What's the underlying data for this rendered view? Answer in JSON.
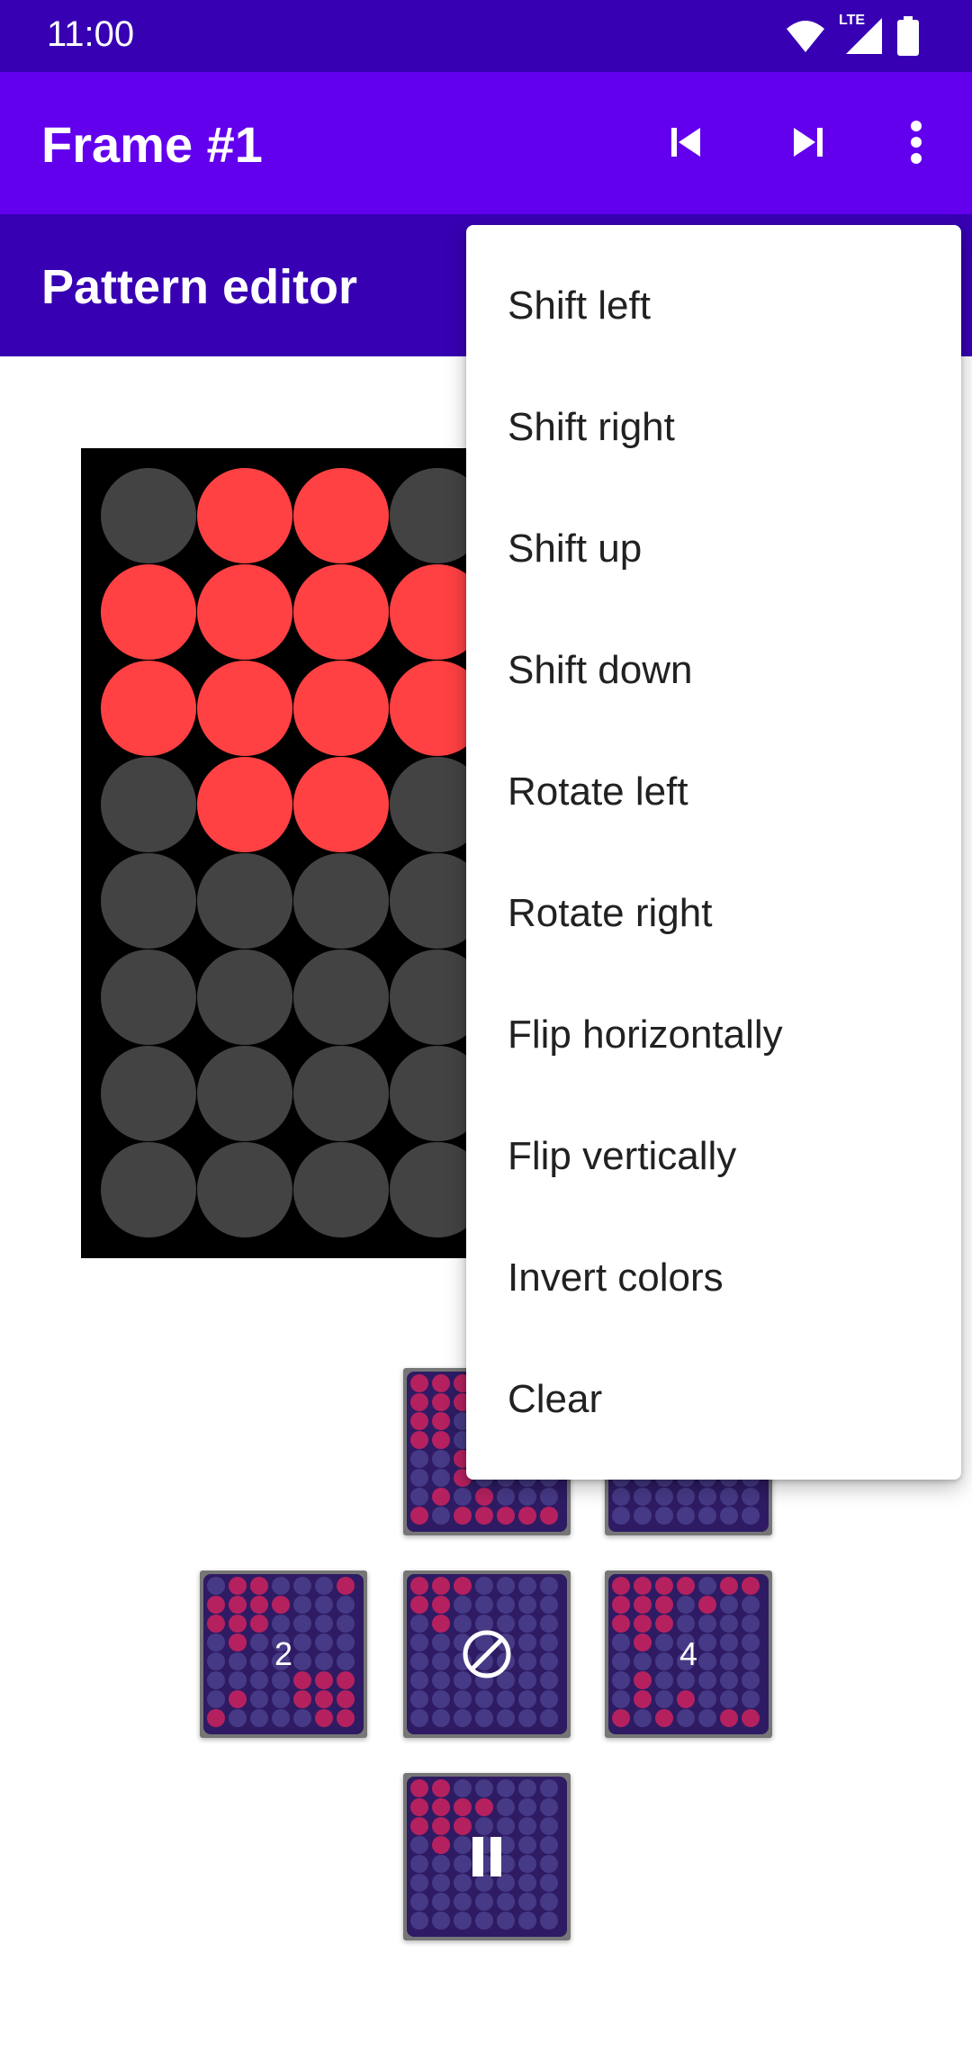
{
  "status": {
    "time": "11:00",
    "network": "LTE"
  },
  "toolbar": {
    "title": "Frame #1"
  },
  "header": {
    "title": "Pattern editor"
  },
  "colors": {
    "primary": "#6200ee",
    "primary_dark": "#3700b3",
    "led_on": "#ff4143",
    "led_off": "#434343",
    "thumb_on": "#b5215f",
    "thumb_off": "#463a86"
  },
  "pattern": {
    "grid": [
      [
        0,
        1,
        1,
        0
      ],
      [
        1,
        1,
        1,
        1
      ],
      [
        1,
        1,
        1,
        1
      ],
      [
        0,
        1,
        1,
        0
      ],
      [
        0,
        0,
        0,
        0
      ],
      [
        0,
        0,
        0,
        0
      ],
      [
        0,
        0,
        0,
        0
      ],
      [
        0,
        0,
        0,
        0
      ]
    ]
  },
  "thumbnails": [
    {
      "label": "",
      "icon": "",
      "grid": [
        "1110000",
        "1110000",
        "1100000",
        "1100000",
        "0010000",
        "0010000",
        "0101000",
        "1011111"
      ]
    },
    {
      "label": "",
      "icon": "",
      "grid": [
        "0000000",
        "0000000",
        "0000000",
        "0000000",
        "0000000",
        "0000000",
        "0000000",
        "0000000"
      ]
    },
    {
      "label": "2",
      "icon": "",
      "grid": [
        "0110001",
        "1111000",
        "1110000",
        "0100000",
        "0000000",
        "0000111",
        "0100111",
        "1000011"
      ]
    },
    {
      "label": "",
      "icon": "block-icon",
      "grid": [
        "1110000",
        "1100000",
        "0100000",
        "0000000",
        "0000000",
        "0000000",
        "0000000",
        "0000000"
      ]
    },
    {
      "label": "4",
      "icon": "",
      "grid": [
        "1111011",
        "1110100",
        "1110000",
        "0100000",
        "0000000",
        "0100000",
        "0101000",
        "1010011"
      ]
    },
    {
      "label": "",
      "icon": "pause-icon",
      "grid": [
        "1100000",
        "1111000",
        "1110000",
        "0100000",
        "0000000",
        "0000000",
        "0000000",
        "0000000"
      ]
    }
  ],
  "menu": {
    "items": [
      "Shift left",
      "Shift right",
      "Shift up",
      "Shift down",
      "Rotate left",
      "Rotate right",
      "Flip horizontally",
      "Flip vertically",
      "Invert colors",
      "Clear"
    ]
  }
}
